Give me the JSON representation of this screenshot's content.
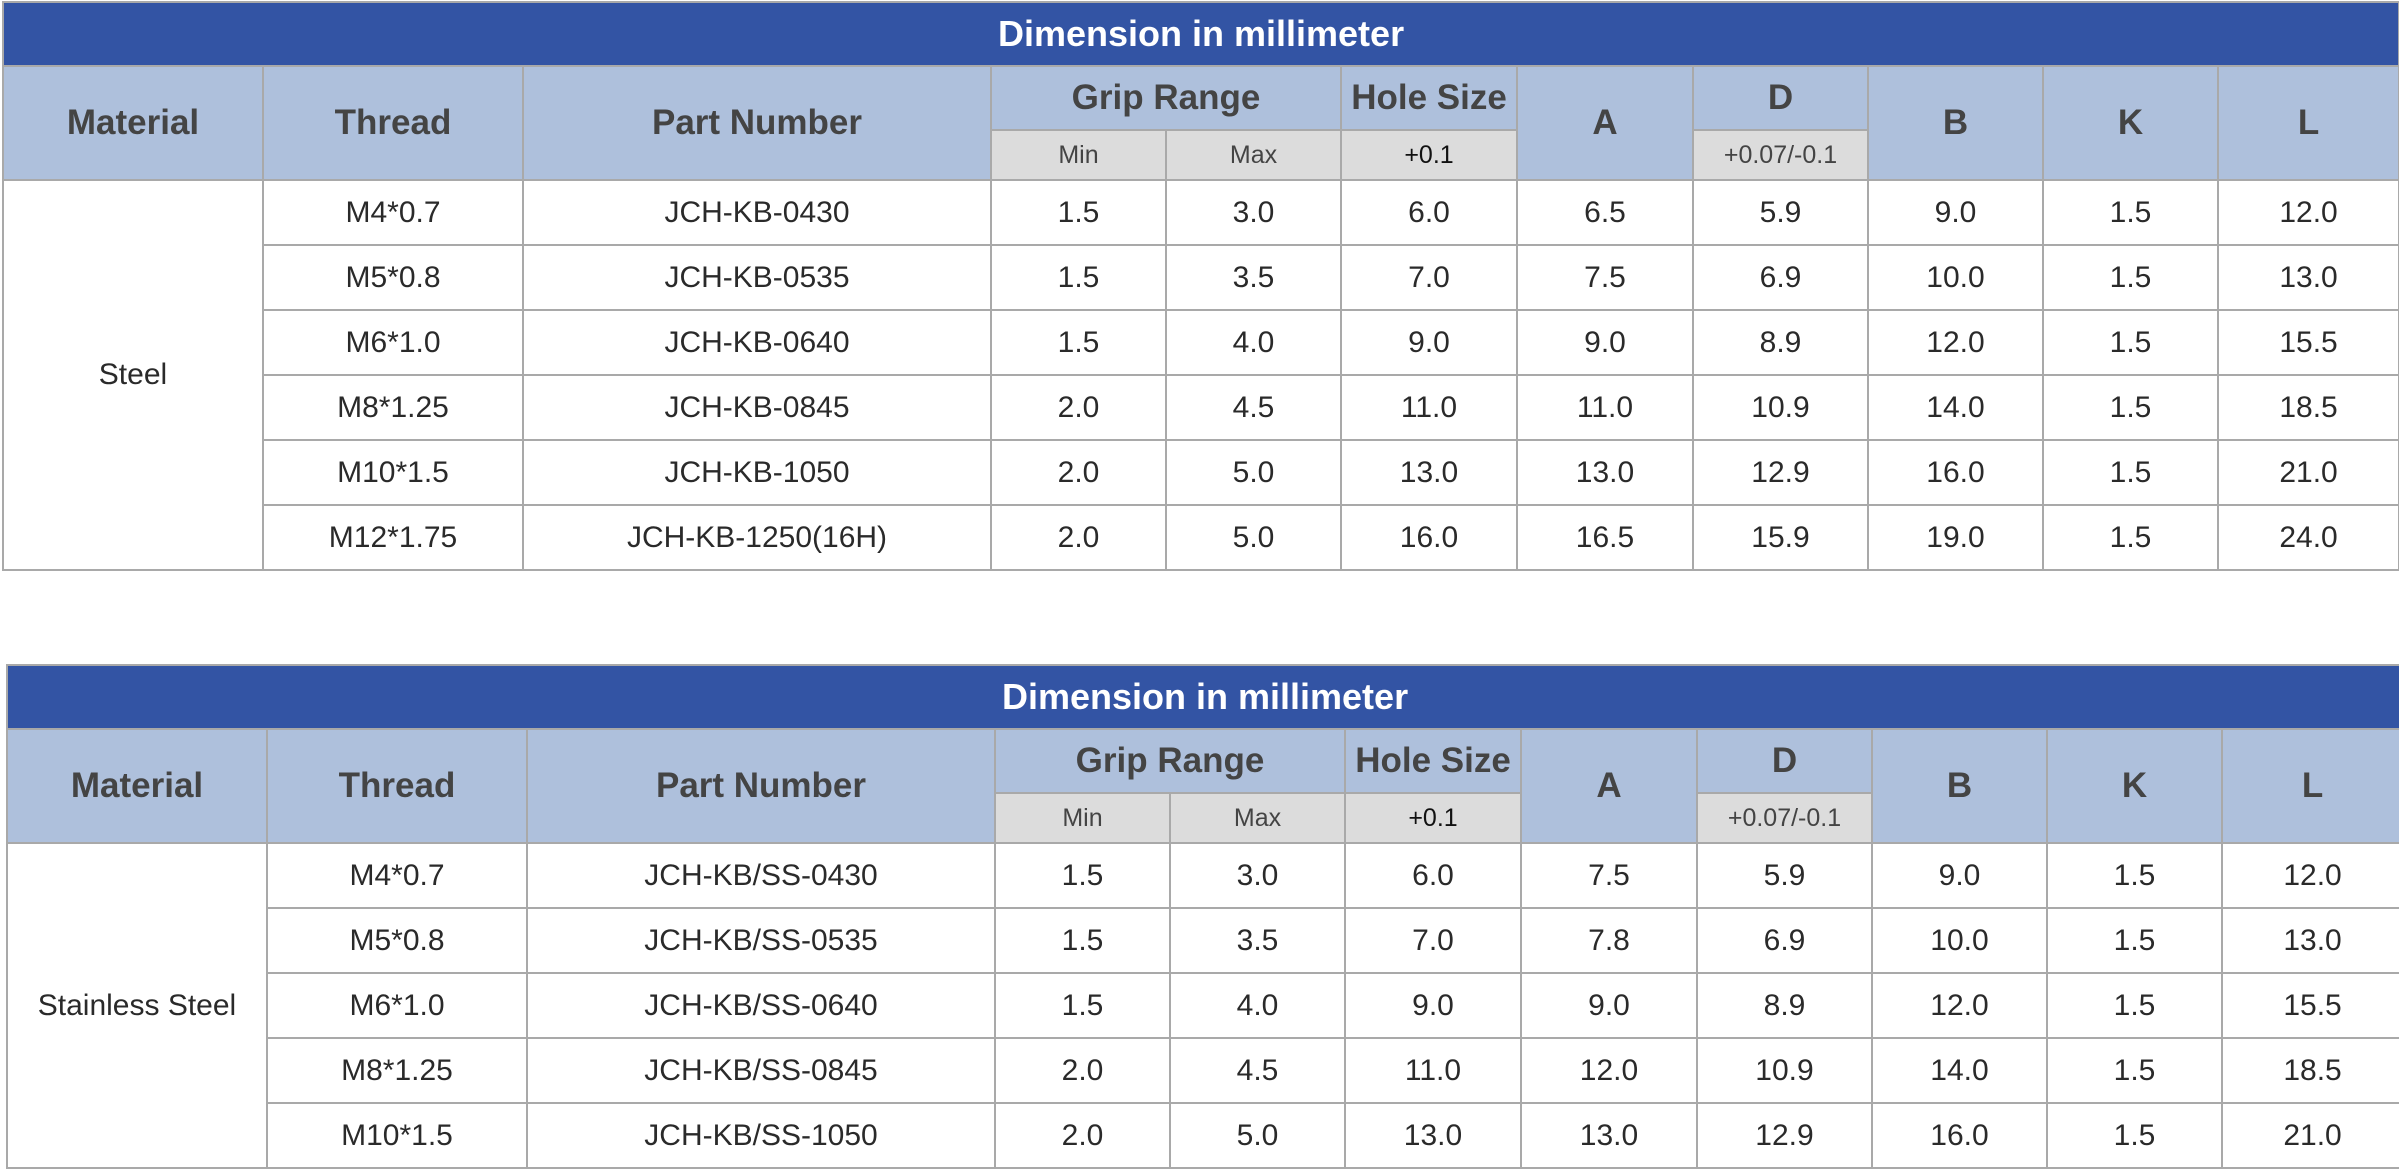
{
  "tables": [
    {
      "title": "Dimension in millimeter",
      "headers": {
        "material": "Material",
        "thread": "Thread",
        "part_number": "Part Number",
        "grip_range": "Grip Range",
        "grip_min": "Min",
        "grip_max": "Max",
        "hole_size": "Hole Size",
        "hole_tol": "+0.1",
        "a": "A",
        "d": "D",
        "d_tol": "+0.07/-0.1",
        "b": "B",
        "k": "K",
        "l": "L"
      },
      "material": "Steel",
      "rows": [
        [
          "M4*0.7",
          "JCH-KB-0430",
          "1.5",
          "3.0",
          "6.0",
          "6.5",
          "5.9",
          "9.0",
          "1.5",
          "12.0"
        ],
        [
          "M5*0.8",
          "JCH-KB-0535",
          "1.5",
          "3.5",
          "7.0",
          "7.5",
          "6.9",
          "10.0",
          "1.5",
          "13.0"
        ],
        [
          "M6*1.0",
          "JCH-KB-0640",
          "1.5",
          "4.0",
          "9.0",
          "9.0",
          "8.9",
          "12.0",
          "1.5",
          "15.5"
        ],
        [
          "M8*1.25",
          "JCH-KB-0845",
          "2.0",
          "4.5",
          "11.0",
          "11.0",
          "10.9",
          "14.0",
          "1.5",
          "18.5"
        ],
        [
          "M10*1.5",
          "JCH-KB-1050",
          "2.0",
          "5.0",
          "13.0",
          "13.0",
          "12.9",
          "16.0",
          "1.5",
          "21.0"
        ],
        [
          "M12*1.75",
          "JCH-KB-1250(16H)",
          "2.0",
          "5.0",
          "16.0",
          "16.5",
          "15.9",
          "19.0",
          "1.5",
          "24.0"
        ]
      ]
    },
    {
      "title": "Dimension in millimeter",
      "headers": {
        "material": "Material",
        "thread": "Thread",
        "part_number": "Part Number",
        "grip_range": "Grip Range",
        "grip_min": "Min",
        "grip_max": "Max",
        "hole_size": "Hole Size",
        "hole_tol": "+0.1",
        "a": "A",
        "d": "D",
        "d_tol": "+0.07/-0.1",
        "b": "B",
        "k": "K",
        "l": "L"
      },
      "material": "Stainless Steel",
      "rows": [
        [
          "M4*0.7",
          "JCH-KB/SS-0430",
          "1.5",
          "3.0",
          "6.0",
          "7.5",
          "5.9",
          "9.0",
          "1.5",
          "12.0"
        ],
        [
          "M5*0.8",
          "JCH-KB/SS-0535",
          "1.5",
          "3.5",
          "7.0",
          "7.8",
          "6.9",
          "10.0",
          "1.5",
          "13.0"
        ],
        [
          "M6*1.0",
          "JCH-KB/SS-0640",
          "1.5",
          "4.0",
          "9.0",
          "9.0",
          "8.9",
          "12.0",
          "1.5",
          "15.5"
        ],
        [
          "M8*1.25",
          "JCH-KB/SS-0845",
          "2.0",
          "4.5",
          "11.0",
          "12.0",
          "10.9",
          "14.0",
          "1.5",
          "18.5"
        ],
        [
          "M10*1.5",
          "JCH-KB/SS-1050",
          "2.0",
          "5.0",
          "13.0",
          "13.0",
          "12.9",
          "16.0",
          "1.5",
          "21.0"
        ]
      ]
    }
  ]
}
